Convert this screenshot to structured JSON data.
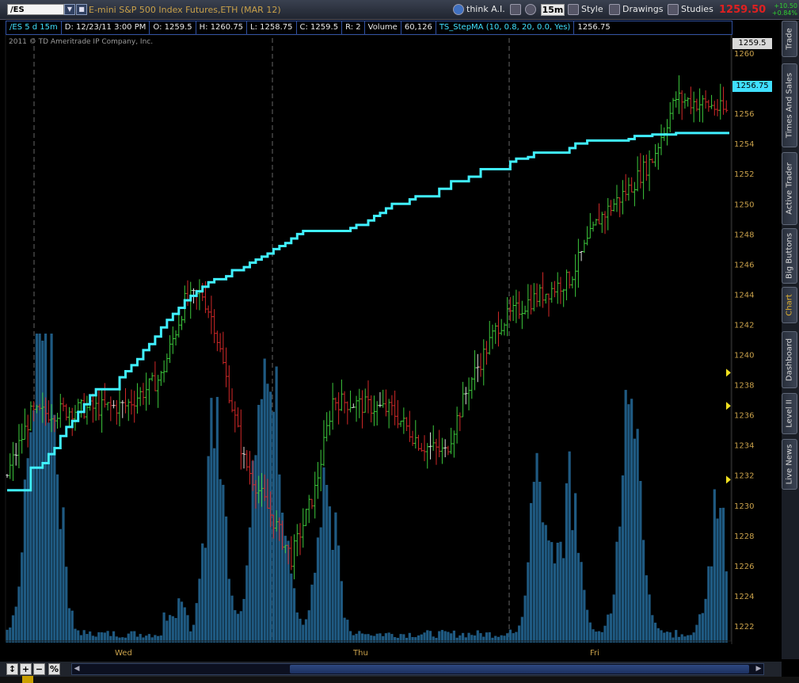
{
  "toolbar": {
    "symbol": "/ES",
    "instrument": "E-mini S&P 500 Index Futures,ETH (MAR 12)",
    "think_ai": "think A.I.",
    "timeframe": "15m",
    "style": "Style",
    "drawings": "Drawings",
    "studies": "Studies",
    "last_price": "1259.50",
    "net_change": "+10.50",
    "pct_change": "+0.84%",
    "icons": [
      "globe-icon",
      "scissors-icon",
      "gear-icon",
      "clock-icon",
      "wrench-icon",
      "pencil-icon",
      "flask-icon"
    ]
  },
  "infobar": {
    "symbol_period": "/ES 5 d 15m",
    "date": "D: 12/23/11 3:00 PM",
    "open": "O: 1259.5",
    "high": "H: 1260.75",
    "low": "L: 1258.75",
    "close": "C: 1259.5",
    "range": "R: 2",
    "volume_label": "Volume",
    "volume_value": "60,126",
    "study": "TS_StepMA (10, 0.8, 20, 0.0, Yes)",
    "study_value": "1256.75"
  },
  "copyright": "2011 © TD Ameritrade IP Company, Inc.",
  "price_axis": {
    "ticks": [
      "1222",
      "1224",
      "1226",
      "1228",
      "1230",
      "1232",
      "1234",
      "1236",
      "1238",
      "1240",
      "1242",
      "1244",
      "1246",
      "1248",
      "1250",
      "1252",
      "1254",
      "1256",
      "1258",
      "1260"
    ],
    "last_price_label": "1259.5",
    "study_label": "1256.75"
  },
  "x_axis": {
    "days": [
      "Wed",
      "Thu",
      "Fri"
    ]
  },
  "side_tabs": [
    {
      "label": "Trade",
      "active": false
    },
    {
      "label": "Times And Sales",
      "active": false
    },
    {
      "label": "Active Trader",
      "active": false
    },
    {
      "label": "Big Buttons",
      "active": false
    },
    {
      "label": "Chart",
      "active": true
    },
    {
      "label": "Dashboard",
      "active": false
    },
    {
      "label": "Level II",
      "active": false
    },
    {
      "label": "Live News",
      "active": false
    }
  ],
  "colors": {
    "up_bar": "#3cc83c",
    "down_bar": "#d02828",
    "neutral_bar": "#dcdcdc",
    "step_ma_up": "#40f0ff",
    "step_ma_down": "#ff30e0",
    "volume": "#1f5a82",
    "price_axis_text": "#c8a04a",
    "last_price": "#e02020"
  },
  "chart_data": {
    "type": "line",
    "ylim": [
      1221,
      1261
    ],
    "categories": [
      "Wed",
      "Thu",
      "Fri"
    ],
    "series": [
      {
        "name": "TS_StepMA (10, 0.8, 20, 0.0, Yes)",
        "x": [
          0,
          7,
          8,
          12,
          14,
          16,
          18,
          20,
          22,
          24,
          26,
          28,
          30,
          38,
          40,
          42,
          44,
          46,
          48,
          50,
          52,
          54,
          56,
          58,
          60,
          62,
          64,
          66,
          68,
          70,
          72,
          74,
          76,
          78,
          80,
          82,
          84,
          86,
          88,
          90,
          92,
          94,
          96,
          98,
          100,
          108,
          116,
          118,
          122,
          124,
          126,
          128,
          130,
          136,
          138,
          146,
          150,
          156,
          160,
          170,
          172,
          176,
          178,
          184,
          190,
          192,
          196,
          210,
          212,
          218,
          226,
          233,
          236
        ],
        "values": [
          1231,
          1231,
          1232.5,
          1232.8,
          1233.4,
          1233.8,
          1234.6,
          1235.2,
          1235.6,
          1236.2,
          1236.7,
          1237.3,
          1237.7,
          1238.5,
          1238.9,
          1239.3,
          1239.7,
          1240.3,
          1240.7,
          1241.2,
          1241.8,
          1242.3,
          1242.7,
          1243.1,
          1243.6,
          1243.9,
          1244.2,
          1244.5,
          1244.8,
          1245.0,
          1245.0,
          1245.2,
          1245.6,
          1245.6,
          1245.8,
          1246.1,
          1246.3,
          1246.5,
          1246.7,
          1247.0,
          1247.2,
          1247.4,
          1247.7,
          1248.0,
          1248.2,
          1248.2,
          1248.4,
          1248.6,
          1248.9,
          1249.2,
          1249.4,
          1249.7,
          1250.0,
          1250.3,
          1250.5,
          1251.0,
          1251.5,
          1251.8,
          1252.3,
          1252.8,
          1253.0,
          1253.1,
          1253.4,
          1253.4,
          1253.7,
          1254.0,
          1254.2,
          1254.3,
          1254.5,
          1254.6,
          1254.7,
          1254.7,
          1254.7
        ]
      }
    ]
  }
}
